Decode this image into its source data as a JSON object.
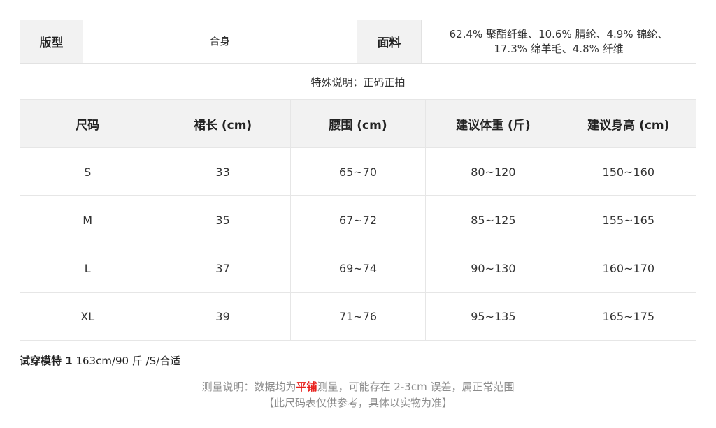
{
  "info": {
    "fit_label": "版型",
    "fit_value": "合身",
    "fabric_label": "面料",
    "fabric_line1": "62.4% 聚酯纤维、10.6% 腈纶、4.9% 锦纶、",
    "fabric_line2": "17.3% 绵羊毛、4.8% 纤维"
  },
  "special_note": "特殊说明：正码正拍",
  "size_table": {
    "headers": [
      "尺码",
      "裙长 (cm)",
      "腰围 (cm)",
      "建议体重 (斤)",
      "建议身高 (cm)"
    ],
    "rows": [
      [
        "S",
        "33",
        "65~70",
        "80~120",
        "150~160"
      ],
      [
        "M",
        "35",
        "67~72",
        "85~125",
        "155~165"
      ],
      [
        "L",
        "37",
        "69~74",
        "90~130",
        "160~170"
      ],
      [
        "XL",
        "39",
        "71~76",
        "95~135",
        "165~175"
      ]
    ]
  },
  "model": {
    "label": "试穿模特 1",
    "value": "163cm/90 斤 /S/合适"
  },
  "measure_note": {
    "prefix": "测量说明：数据均为",
    "highlight": "平铺",
    "suffix": "测量，可能存在 2-3cm 误差，属正常范围",
    "highlight_color": "#e8211d"
  },
  "reference_note": "【此尺码表仅供参考，具体以实物为准】"
}
